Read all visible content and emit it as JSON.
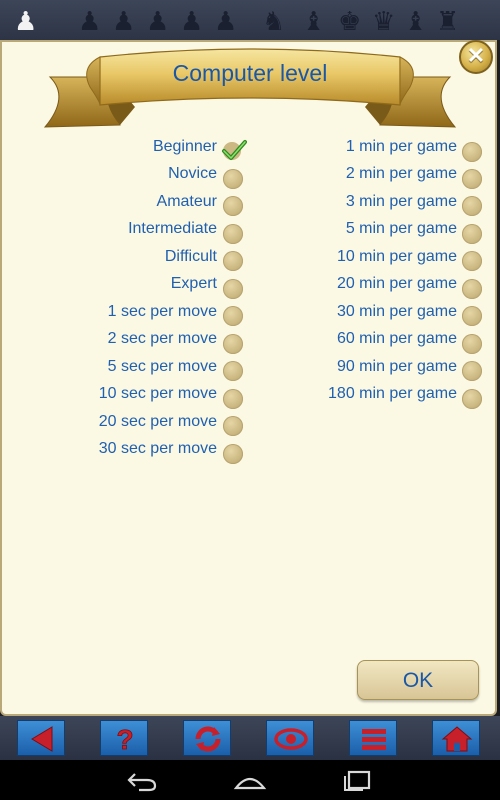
{
  "dialog": {
    "title": "Computer level",
    "ok_label": "OK",
    "close_icon": "close-icon"
  },
  "levels": [
    {
      "label": "Beginner",
      "selected": true
    },
    {
      "label": "Novice",
      "selected": false
    },
    {
      "label": "Amateur",
      "selected": false
    },
    {
      "label": "Intermediate",
      "selected": false
    },
    {
      "label": "Difficult",
      "selected": false
    },
    {
      "label": "Expert",
      "selected": false
    },
    {
      "label": "1 sec per move",
      "selected": false
    },
    {
      "label": "2 sec per move",
      "selected": false
    },
    {
      "label": "5 sec per move",
      "selected": false
    },
    {
      "label": "10 sec per move",
      "selected": false
    },
    {
      "label": "20 sec per move",
      "selected": false
    },
    {
      "label": "30 sec per move",
      "selected": false
    }
  ],
  "game_times": [
    {
      "label": "1 min per game",
      "selected": false
    },
    {
      "label": "2 min per game",
      "selected": false
    },
    {
      "label": "3 min per game",
      "selected": false
    },
    {
      "label": "5 min per game",
      "selected": false
    },
    {
      "label": "10 min per game",
      "selected": false
    },
    {
      "label": "20 min per game",
      "selected": false
    },
    {
      "label": "30 min per game",
      "selected": false
    },
    {
      "label": "60 min per game",
      "selected": false
    },
    {
      "label": "90 min per game",
      "selected": false
    },
    {
      "label": "180 min per game",
      "selected": false
    }
  ],
  "toolbar": {
    "buttons": [
      "back-arrow-icon",
      "help-icon",
      "rotate-board-icon",
      "eye-icon",
      "menu-icon",
      "home-icon"
    ]
  },
  "colors": {
    "accent_blue": "#1a57a6",
    "dialog_bg": "#fbf8e4",
    "toolbar_button": "#1b5fa9",
    "toolbar_icon": "#c8202a"
  }
}
